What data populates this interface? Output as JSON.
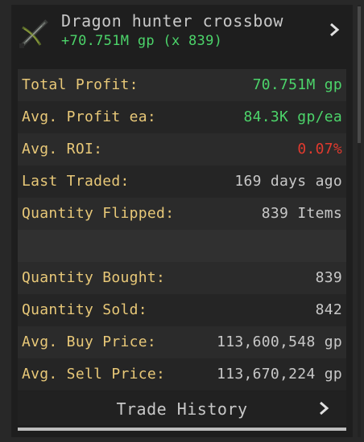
{
  "item": {
    "name": "Dragon hunter crossbow",
    "summary": "+70.751M gp (x 839)",
    "icon": "crossbow-icon"
  },
  "stats": [
    {
      "label": "Total Profit:",
      "value": "70.751M gp",
      "color": "#4cd46a"
    },
    {
      "label": "Avg. Profit ea:",
      "value": "84.3K gp/ea",
      "color": "#4cd46a"
    },
    {
      "label": "Avg. ROI:",
      "value": "0.07%",
      "color": "#e03a2e"
    },
    {
      "label": "Last Traded:",
      "value": "169 days ago",
      "color": "#c8c8c8"
    },
    {
      "label": "Quantity Flipped:",
      "value": "839 Items",
      "color": "#c8c8c8"
    }
  ],
  "details": [
    {
      "label": "Quantity Bought:",
      "value": "839",
      "color": "#c8c8c8"
    },
    {
      "label": "Quantity Sold:",
      "value": "842",
      "color": "#c8c8c8"
    },
    {
      "label": "Avg. Buy Price:",
      "value": "113,600,548 gp",
      "color": "#c8c8c8"
    },
    {
      "label": "Avg. Sell Price:",
      "value": "113,670,224 gp",
      "color": "#c8c8c8"
    }
  ],
  "footer": {
    "label": "Trade History",
    "icon": "chevron-right-icon"
  },
  "colors": {
    "label": "#e8c878",
    "profit": "#4cd46a",
    "loss": "#e03a2e",
    "neutral": "#c8c8c8"
  }
}
